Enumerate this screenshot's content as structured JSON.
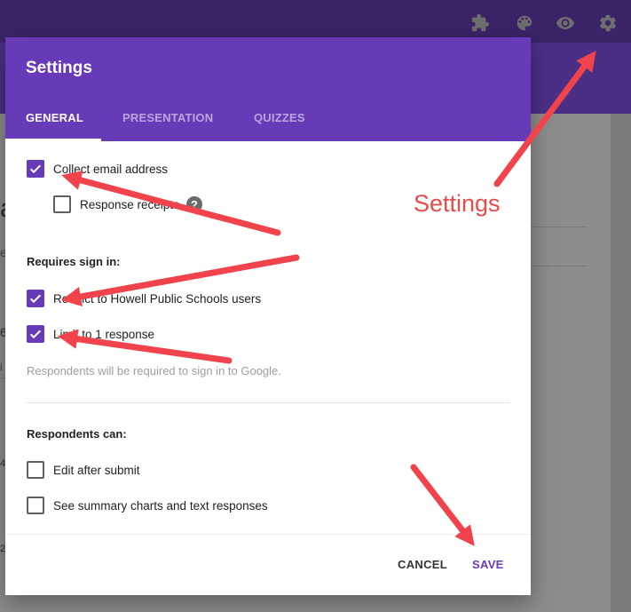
{
  "topbar": {
    "icons": [
      "puzzle-icon",
      "palette-icon",
      "eye-icon",
      "gear-icon"
    ]
  },
  "dialog": {
    "title": "Settings",
    "tabs": [
      {
        "label": "GENERAL",
        "active": true
      },
      {
        "label": "PRESENTATION",
        "active": false
      },
      {
        "label": "QUIZZES",
        "active": false
      }
    ],
    "collect_email": {
      "label": "Collect email address",
      "checked": true
    },
    "response_receipts": {
      "label": "Response receipts",
      "checked": false,
      "help": "?"
    },
    "requires_sign_in": {
      "heading": "Requires sign in:",
      "restrict": {
        "label": "Restrict to Howell Public Schools users",
        "checked": true
      },
      "limit": {
        "label": "Limit to 1 response",
        "checked": true
      },
      "helper": "Respondents will be required to sign in to Google."
    },
    "respondents_can": {
      "heading": "Respondents can:",
      "edit": {
        "label": "Edit after submit",
        "checked": false
      },
      "summary": {
        "label": "See summary charts and text responses",
        "checked": false
      }
    },
    "buttons": {
      "cancel": "CANCEL",
      "save": "SAVE"
    }
  },
  "annotation": {
    "label": "Settings"
  },
  "background_fragments": [
    "a",
    "e",
    "6",
    "i",
    "4",
    "2"
  ],
  "colors": {
    "accent": "#673ab7",
    "arrow": "#f0434b",
    "topbar": "#3a2468"
  }
}
